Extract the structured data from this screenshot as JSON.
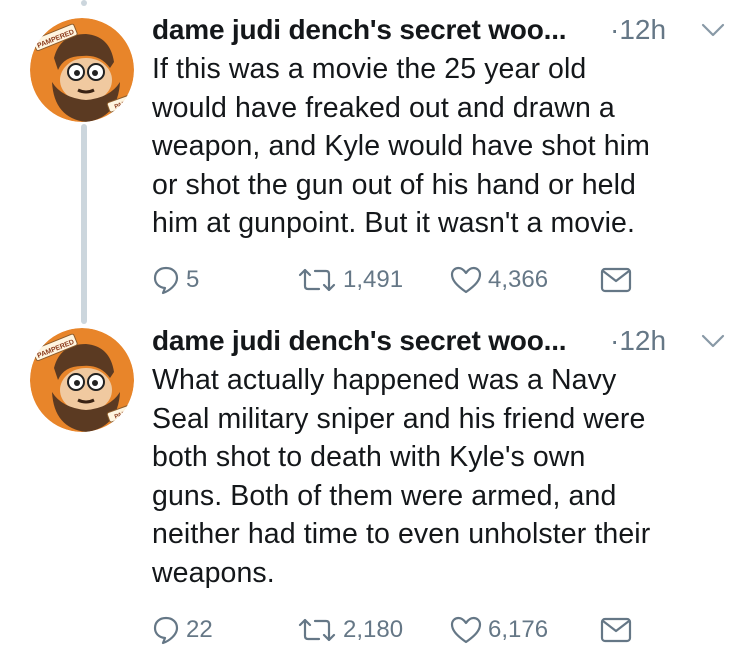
{
  "tweets": [
    {
      "author": "dame judi dench's secret woo...",
      "time": "·12h",
      "text": "If this was a movie the 25 year old\nwould have freaked out and drawn a\nweapon, and Kyle would have shot him\nor shot the gun out of his hand or held\nhim at gunpoint. But it wasn't a movie.",
      "replies": "5",
      "retweets": "1,491",
      "likes": "4,366",
      "avatar_badge_top": "PAMPERED",
      "avatar_badge_bottom": "PAIN"
    },
    {
      "author": "dame judi dench's secret woo...",
      "time": "·12h",
      "text": "What actually happened was a Navy\nSeal military sniper and his friend were\nboth shot to death with Kyle's own\nguns. Both of them were armed, and\nneither had time to even unholster their\nweapons.",
      "replies": "22",
      "retweets": "2,180",
      "likes": "6,176",
      "avatar_badge_top": "PAMPERED",
      "avatar_badge_bottom": "PAIN"
    }
  ],
  "colors": {
    "thread_line": "#ccd6dd",
    "meta_text": "#657786",
    "avatar_bg": "#e8852a",
    "beard": "#5b3a22"
  },
  "icons": [
    "reply-icon",
    "retweet-icon",
    "like-icon",
    "message-icon",
    "chevron-down-icon"
  ]
}
